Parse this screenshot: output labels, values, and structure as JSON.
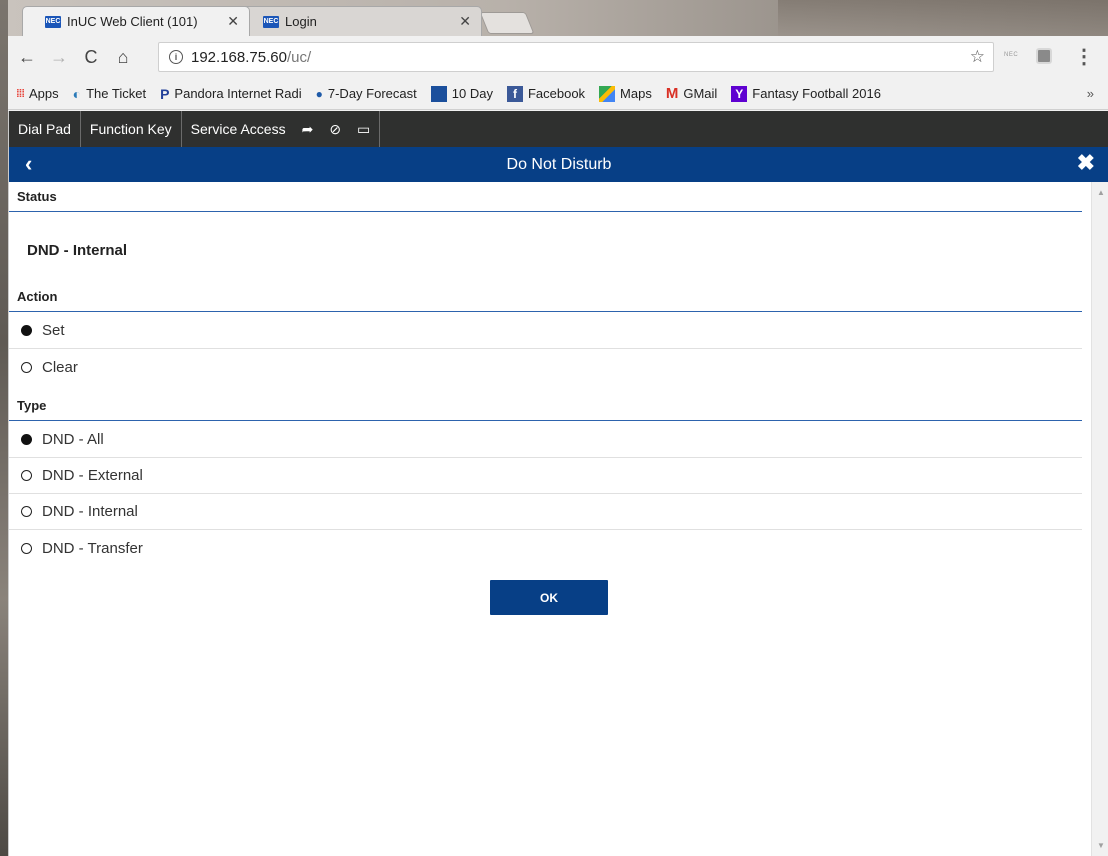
{
  "browser": {
    "tabs": [
      {
        "title": "InUC Web Client (101)",
        "favicon": "NEC",
        "active": true
      },
      {
        "title": "Login",
        "favicon": "NEC",
        "active": false
      }
    ],
    "url_host": "192.168.75.60",
    "url_path": "/uc/",
    "bookmarks": [
      {
        "label": "Apps",
        "icon": "apps-grid-icon",
        "color": "#e8453c"
      },
      {
        "label": "The Ticket",
        "icon": "ticket-logo-icon",
        "color": "#2a7ab8"
      },
      {
        "label": "Pandora Internet Radi",
        "icon": "pandora-icon",
        "color": "#224099"
      },
      {
        "label": "7-Day Forecast",
        "icon": "noaa-icon",
        "color": "#1e5aa8"
      },
      {
        "label": "10 Day",
        "icon": "weather-channel-icon",
        "color": "#1b4f9c"
      },
      {
        "label": "Facebook",
        "icon": "facebook-icon",
        "color": "#3b5998"
      },
      {
        "label": "Maps",
        "icon": "maps-icon",
        "color": "#34a853"
      },
      {
        "label": "GMail",
        "icon": "gmail-icon",
        "color": "#d93025"
      },
      {
        "label": "Fantasy Football 2016",
        "icon": "yahoo-icon",
        "color": "#5f01d1"
      }
    ],
    "more_label": "»"
  },
  "app": {
    "nav": {
      "dial_pad": "Dial Pad",
      "function_key": "Function Key",
      "service_access": "Service Access"
    },
    "title": "Do Not Disturb",
    "status_header": "Status",
    "status_value": "DND - Internal",
    "action_header": "Action",
    "actions": [
      {
        "label": "Set",
        "selected": true
      },
      {
        "label": "Clear",
        "selected": false
      }
    ],
    "type_header": "Type",
    "types": [
      {
        "label": "DND - All",
        "selected": true
      },
      {
        "label": "DND - External",
        "selected": false
      },
      {
        "label": "DND - Internal",
        "selected": false
      },
      {
        "label": "DND - Transfer",
        "selected": false
      }
    ],
    "ok_label": "OK",
    "colors": {
      "nav_bg": "#2f302f",
      "title_bg": "#073f86",
      "divider": "#2d63ad"
    }
  }
}
